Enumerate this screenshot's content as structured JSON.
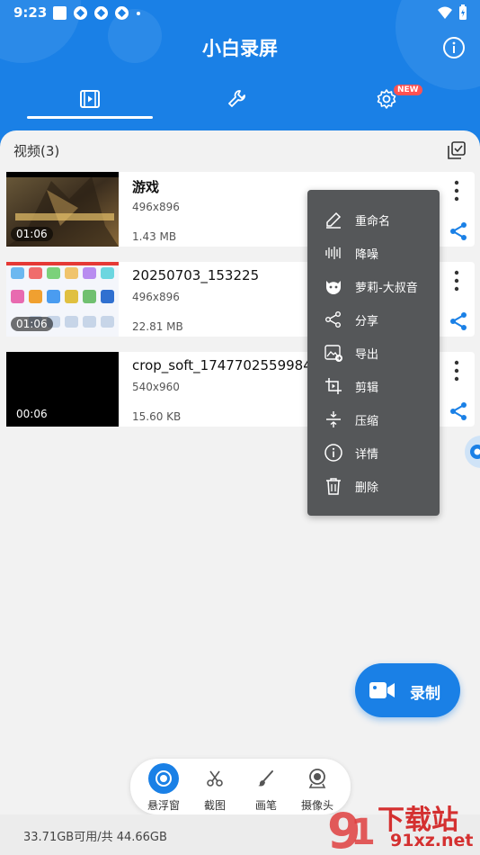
{
  "status_bar": {
    "time": "9:23"
  },
  "header": {
    "title": "小白录屏",
    "new_badge": "NEW"
  },
  "tabs": [
    {
      "icon": "video-icon"
    },
    {
      "icon": "wrench-icon"
    },
    {
      "icon": "gear-icon"
    }
  ],
  "section": {
    "title": "视频(3)"
  },
  "videos": [
    {
      "name": "游戏",
      "resolution": "496x896",
      "size": "1.43 MB",
      "duration": "01:06",
      "thumb": "game-poster"
    },
    {
      "name": "20250703_153225",
      "resolution": "496x896",
      "size": "22.81 MB",
      "duration": "01:06",
      "thumb": "app-grid"
    },
    {
      "name": "crop_soft_1747702559984",
      "resolution": "540x960",
      "size": "15.60 KB",
      "duration": "00:06",
      "thumb": "black"
    }
  ],
  "context_menu": [
    {
      "label": "重命名",
      "icon": "pencil-icon"
    },
    {
      "label": "降噪",
      "icon": "waveform-icon"
    },
    {
      "label": "萝莉-大叔音",
      "icon": "voice-face-icon"
    },
    {
      "label": "分享",
      "icon": "share-icon"
    },
    {
      "label": "导出",
      "icon": "image-export-icon"
    },
    {
      "label": "剪辑",
      "icon": "crop-icon"
    },
    {
      "label": "压缩",
      "icon": "compress-icon"
    },
    {
      "label": "详情",
      "icon": "info-icon"
    },
    {
      "label": "删除",
      "icon": "trash-icon"
    }
  ],
  "record_button": {
    "label": "录制"
  },
  "toolbar": [
    {
      "label": "悬浮窗",
      "icon": "float-window-icon"
    },
    {
      "label": "截图",
      "icon": "scissors-icon"
    },
    {
      "label": "画笔",
      "icon": "brush-icon"
    },
    {
      "label": "摄像头",
      "icon": "camera-icon"
    }
  ],
  "storage": {
    "text": "33.71GB可用/共 44.66GB"
  },
  "watermark": {
    "big": "下载站",
    "small": "91xz.net"
  },
  "colors": {
    "primary": "#1a80e6",
    "menu_bg": "#555759",
    "badge": "#ff5252"
  }
}
